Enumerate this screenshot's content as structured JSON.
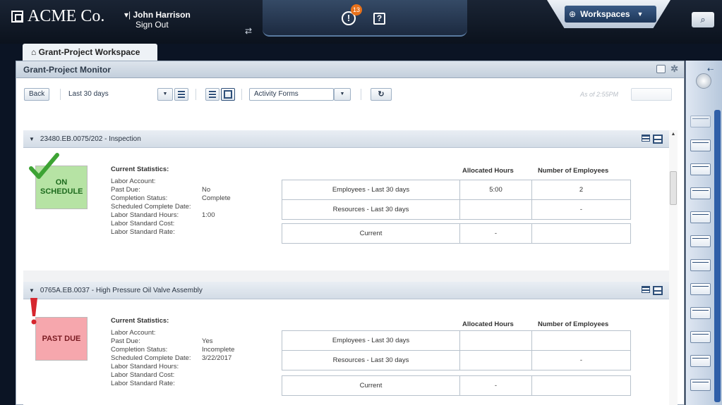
{
  "header": {
    "brand": "ACME Co.",
    "user_name": "John Harrison",
    "user_prefix": "▾|",
    "sign_out": "Sign Out",
    "alert_count": "13",
    "workspaces_label": "Workspaces",
    "globe_glyph": "⊕",
    "caret_glyph": "▼",
    "search_glyph": "⌕"
  },
  "tab": {
    "label": "Grant-Project Workspace",
    "icon": "home-icon"
  },
  "panel": {
    "title": "Grant-Project Monitor"
  },
  "toolbar": {
    "back_label": "Back",
    "period_value": "Last 30 days",
    "form_value": "Activity Forms",
    "as_of": "As of 2:55PM",
    "export_label": "",
    "caret_glyph": "▼",
    "refresh_glyph": "↻"
  },
  "sections": [
    {
      "id": "23480.EB.0075/202 - Inspection",
      "status": "ON SCHEDULE",
      "status_color": "#b6e3a4",
      "indicator": "check-icon",
      "stats_title": "Current Statistics:",
      "stats": [
        {
          "label": "Labor Account:",
          "value": ""
        },
        {
          "label": "Past Due:",
          "value": "No"
        },
        {
          "label": "Completion Status:",
          "value": "Complete"
        },
        {
          "label": "Scheduled Complete Date:",
          "value": ""
        },
        {
          "label": "Labor Standard Hours:",
          "value": "1:00"
        },
        {
          "label": "Labor Standard Cost:",
          "value": ""
        },
        {
          "label": "Labor Standard Rate:",
          "value": ""
        }
      ],
      "columns": [
        "Allocated Hours",
        "Number of Employees"
      ],
      "rows": [
        {
          "label": "Employees - Last 30 days",
          "hours": "5:00",
          "employees": "2"
        },
        {
          "label": "Resources - Last 30 days",
          "hours": "",
          "employees": "-"
        }
      ],
      "current": {
        "label": "Current",
        "hours": "-",
        "employees": ""
      }
    },
    {
      "id": "0765A.EB.0037 - High Pressure Oil Valve Assembly",
      "status": "PAST DUE",
      "status_color": "#f6a7ad",
      "indicator": "exclamation-icon",
      "stats_title": "Current Statistics:",
      "stats": [
        {
          "label": "Labor Account:",
          "value": ""
        },
        {
          "label": "Past Due:",
          "value": "Yes"
        },
        {
          "label": "Completion Status:",
          "value": "Incomplete"
        },
        {
          "label": "Scheduled Complete Date:",
          "value": "3/22/2017"
        },
        {
          "label": "Labor Standard Hours:",
          "value": ""
        },
        {
          "label": "Labor Standard Cost:",
          "value": ""
        },
        {
          "label": "Labor Standard Rate:",
          "value": ""
        }
      ],
      "columns": [
        "Allocated Hours",
        "Number of Employees"
      ],
      "rows": [
        {
          "label": "Employees - Last 30 days",
          "hours": "",
          "employees": ""
        },
        {
          "label": "Resources - Last 30 days",
          "hours": "",
          "employees": "-"
        }
      ],
      "current": {
        "label": "Current",
        "hours": "-",
        "employees": ""
      }
    }
  ],
  "colors": {
    "header_bg": "#0b121d",
    "accent_blue": "#2e4f79",
    "on_schedule_text": "#1e6b1e",
    "past_due_text": "#7a1b22",
    "check_green": "#3da334",
    "alert_red": "#d6262e",
    "badge_orange": "#e8711a"
  },
  "dock": {
    "item_count": 11
  }
}
